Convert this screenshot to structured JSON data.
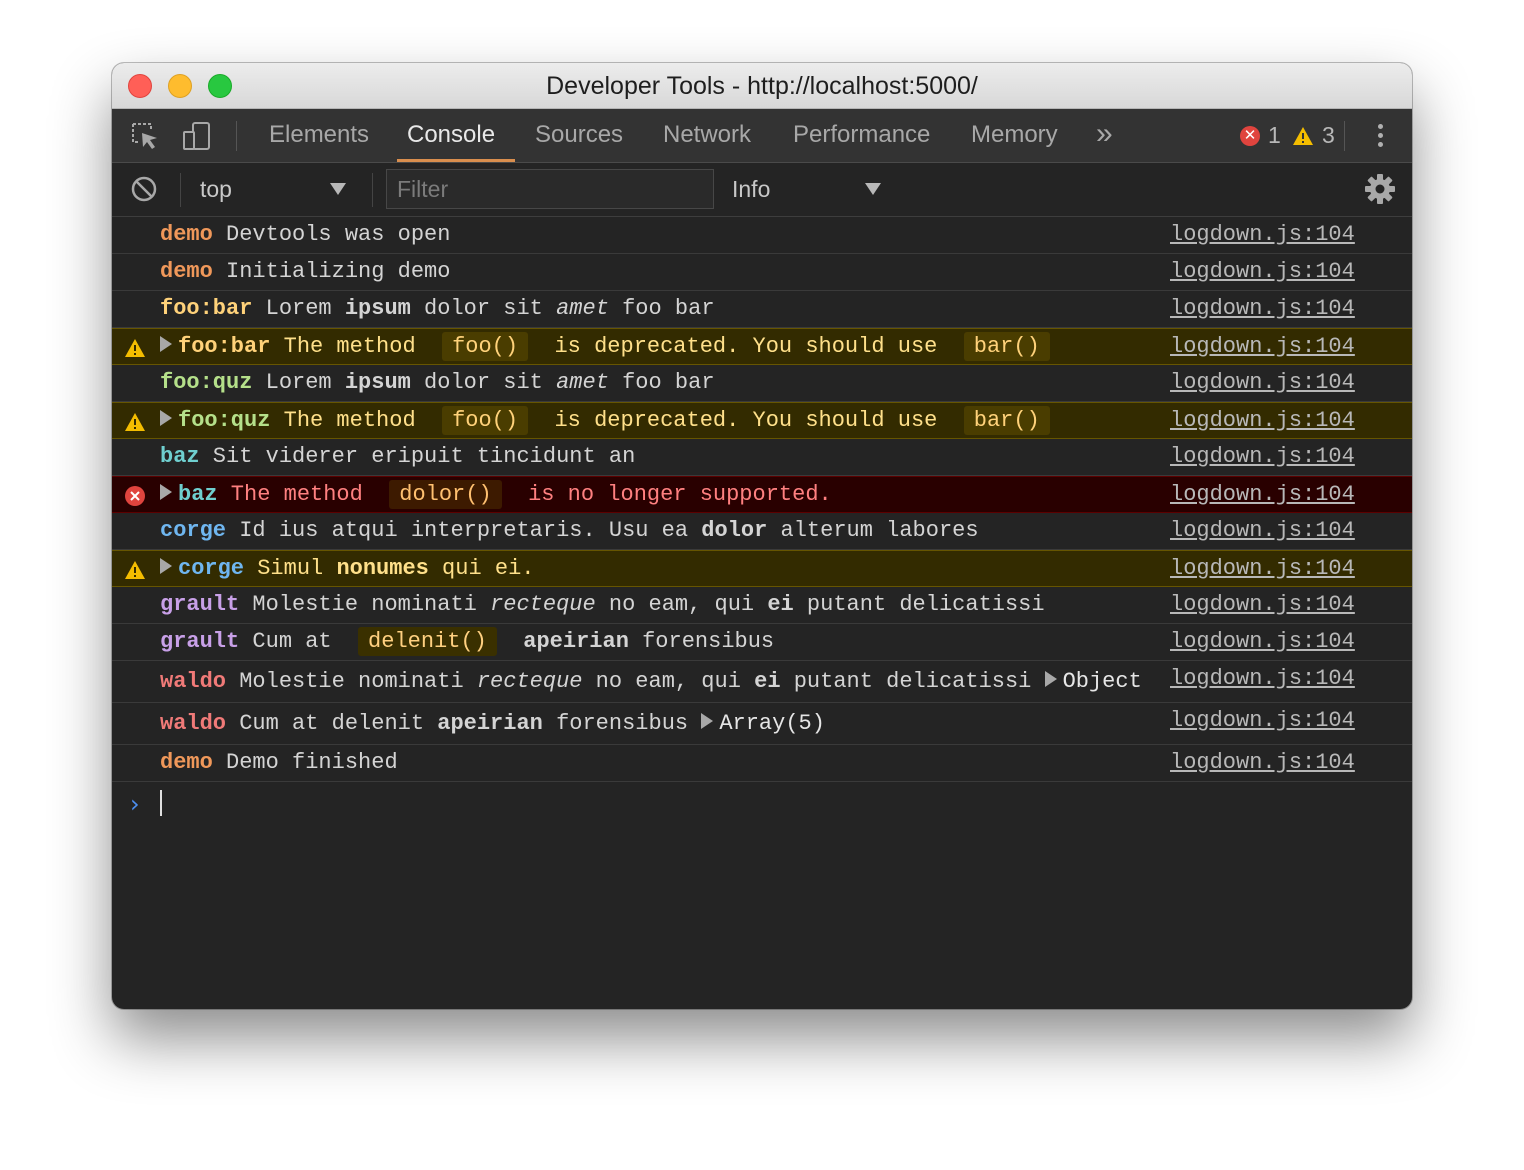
{
  "window": {
    "title": "Developer Tools - http://localhost:5000/"
  },
  "tabs": [
    {
      "label": "Elements",
      "active": false
    },
    {
      "label": "Console",
      "active": true
    },
    {
      "label": "Sources",
      "active": false
    },
    {
      "label": "Network",
      "active": false
    },
    {
      "label": "Performance",
      "active": false
    },
    {
      "label": "Memory",
      "active": false
    }
  ],
  "more_tabs_label": "»",
  "counters": {
    "errors": "1",
    "warnings": "3"
  },
  "toolbar": {
    "context": "top",
    "filter_placeholder": "Filter",
    "level": "Info"
  },
  "colors": {
    "demo": "#f0985a",
    "foo": "#ffd27a",
    "fooquz": "#b5e08a",
    "baz": "#6fcfcf",
    "corge": "#6fb6f0",
    "grault": "#c8a0e8",
    "waldo": "#f07a78",
    "warn_bg": "#332b00",
    "error_bg": "#290000"
  },
  "source_link": "logdown.js:104",
  "messages": [
    {
      "level": "log",
      "ns": "demo",
      "ns_color": "demo",
      "parts": [
        [
          "t",
          " Devtools was open"
        ]
      ]
    },
    {
      "level": "log",
      "ns": "demo",
      "ns_color": "demo",
      "parts": [
        [
          "t",
          " Initializing demo"
        ]
      ]
    },
    {
      "level": "log",
      "ns": "foo:bar",
      "ns_color": "foo",
      "parts": [
        [
          "t",
          " Lorem "
        ],
        [
          "b",
          "ipsum"
        ],
        [
          "t",
          " dolor sit "
        ],
        [
          "i",
          "amet"
        ],
        [
          "t",
          " foo bar"
        ]
      ]
    },
    {
      "level": "warn",
      "ns": "foo:bar",
      "ns_color": "foo",
      "parts": [
        [
          "t",
          " The method "
        ],
        [
          "c",
          "foo()"
        ],
        [
          "t",
          " is deprecated. You should use "
        ],
        [
          "c",
          "bar()"
        ]
      ]
    },
    {
      "level": "log",
      "ns": "foo:quz",
      "ns_color": "fooquz",
      "parts": [
        [
          "t",
          " Lorem "
        ],
        [
          "b",
          "ipsum"
        ],
        [
          "t",
          " dolor sit "
        ],
        [
          "i",
          "amet"
        ],
        [
          "t",
          " foo bar"
        ]
      ]
    },
    {
      "level": "warn",
      "ns": "foo:quz",
      "ns_color": "fooquz",
      "parts": [
        [
          "t",
          " The method "
        ],
        [
          "c",
          "foo()"
        ],
        [
          "t",
          " is deprecated. You should use "
        ],
        [
          "c",
          "bar()"
        ]
      ]
    },
    {
      "level": "log",
      "ns": "baz",
      "ns_color": "baz",
      "parts": [
        [
          "t",
          " Sit viderer eripuit tincidunt an"
        ]
      ]
    },
    {
      "level": "error",
      "ns": "baz",
      "ns_color": "baz",
      "parts": [
        [
          "t",
          " The method "
        ],
        [
          "c",
          "dolor()"
        ],
        [
          "t",
          " is no longer supported."
        ]
      ]
    },
    {
      "level": "log",
      "ns": "corge",
      "ns_color": "corge",
      "parts": [
        [
          "t",
          " Id ius atqui interpretaris. Usu ea "
        ],
        [
          "b",
          "dolor"
        ],
        [
          "t",
          " alterum labores"
        ]
      ]
    },
    {
      "level": "warn",
      "ns": "corge",
      "ns_color": "corge",
      "parts": [
        [
          "t",
          " Simul "
        ],
        [
          "b",
          "nonumes"
        ],
        [
          "t",
          " qui ei."
        ]
      ]
    },
    {
      "level": "log",
      "ns": "grault",
      "ns_color": "grault",
      "parts": [
        [
          "t",
          " Molestie nominati "
        ],
        [
          "i",
          "recteque"
        ],
        [
          "t",
          " no eam, qui "
        ],
        [
          "b",
          "ei"
        ],
        [
          "t",
          " putant delicatissi"
        ]
      ]
    },
    {
      "level": "log",
      "ns": "grault",
      "ns_color": "grault",
      "parts": [
        [
          "t",
          " Cum at "
        ],
        [
          "c",
          "delenit()"
        ],
        [
          "t",
          " "
        ],
        [
          "b",
          "apeirian"
        ],
        [
          "t",
          " forensibus"
        ]
      ]
    },
    {
      "level": "log",
      "tall": true,
      "ns": "waldo",
      "ns_color": "waldo",
      "parts": [
        [
          "t",
          " Molestie nominati "
        ],
        [
          "i",
          "recteque"
        ],
        [
          "t",
          " no eam, qui "
        ],
        [
          "b",
          "ei"
        ],
        [
          "t",
          " putant delicatissi "
        ],
        [
          "o",
          "Object"
        ]
      ]
    },
    {
      "level": "log",
      "tall": true,
      "ns": "waldo",
      "ns_color": "waldo",
      "parts": [
        [
          "t",
          " Cum at delenit "
        ],
        [
          "b",
          "apeirian"
        ],
        [
          "t",
          " forensibus "
        ],
        [
          "o",
          "Array(5)"
        ]
      ]
    },
    {
      "level": "log",
      "ns": "demo",
      "ns_color": "demo",
      "parts": [
        [
          "t",
          " Demo finished"
        ]
      ]
    }
  ],
  "prompt": {
    "symbol": "›"
  }
}
